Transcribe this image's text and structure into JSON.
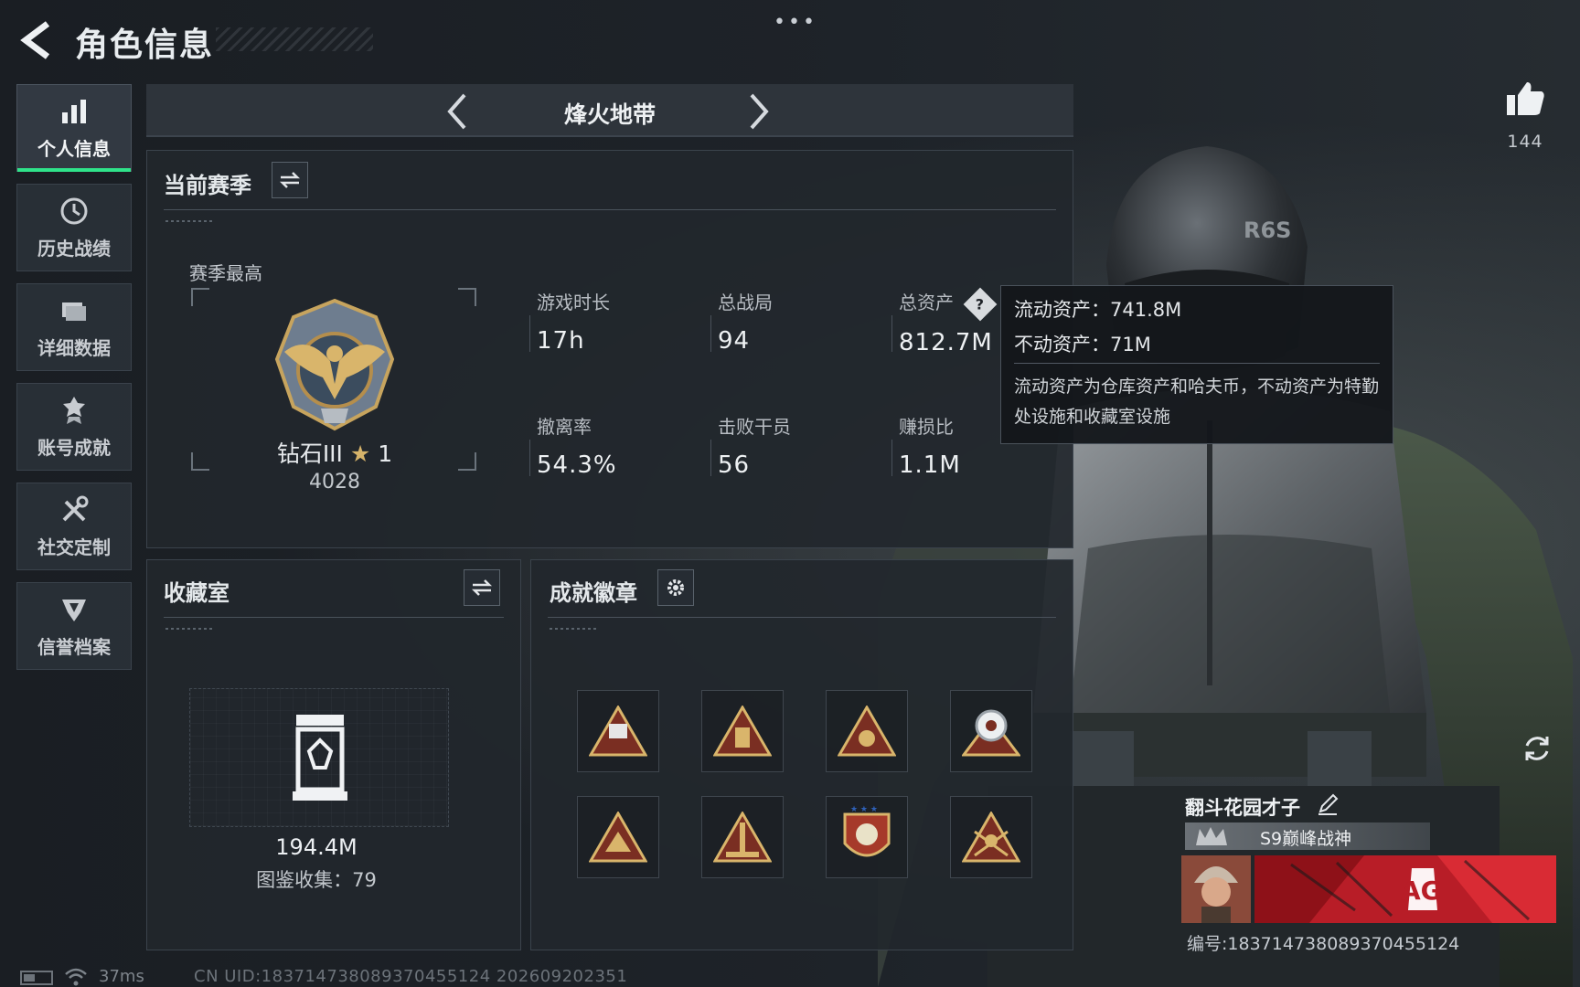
{
  "header": {
    "title": "角色信息",
    "menu_dots": "•••"
  },
  "sidebar": {
    "items": [
      {
        "label": "个人信息",
        "icon": "bar-chart-icon",
        "active": true
      },
      {
        "label": "历史战绩",
        "icon": "history-clock-icon",
        "active": false
      },
      {
        "label": "详细数据",
        "icon": "folder-icon",
        "active": false
      },
      {
        "label": "账号成就",
        "icon": "achievement-medal-icon",
        "active": false
      },
      {
        "label": "社交定制",
        "icon": "tools-icon",
        "active": false
      },
      {
        "label": "信誉档案",
        "icon": "shield-emblem-icon",
        "active": false
      }
    ]
  },
  "mode": {
    "title": "烽火地带"
  },
  "season": {
    "title": "当前赛季",
    "best_label": "赛季最高",
    "rank": {
      "name": "钻石III",
      "stars": "1",
      "score": "4028"
    },
    "stats": [
      {
        "label": "游戏时长",
        "value": "17h"
      },
      {
        "label": "总战局",
        "value": "94"
      },
      {
        "label": "总资产",
        "value": "812.7M"
      },
      {
        "label": "撤离率",
        "value": "54.3%"
      },
      {
        "label": "击败干员",
        "value": "56"
      },
      {
        "label": "赚损比",
        "value": "1.1M"
      }
    ],
    "help_mark": "?"
  },
  "tooltip": {
    "liquid": "流动资产：741.8M",
    "fixed": "不动资产：71M",
    "note": "流动资产为仓库资产和哈夫币，不动资产为特勤处设施和收藏室设施"
  },
  "collection": {
    "title": "收藏室",
    "value": "194.4M",
    "count": "图鉴收集：79"
  },
  "badges": {
    "title": "成就徽章"
  },
  "profile": {
    "likes": "144",
    "name": "翻斗花园才子",
    "title": "S9巅峰战神",
    "id": "编号:1837147380893704551​24",
    "banner_text": "AG"
  },
  "footer": {
    "ping": "37ms",
    "uid": "CN UID:183714738089370455124 202609202351"
  },
  "colors": {
    "active_accent": "#2fe38a",
    "background": "#1b1f24",
    "banner_red": "#c9202a"
  }
}
